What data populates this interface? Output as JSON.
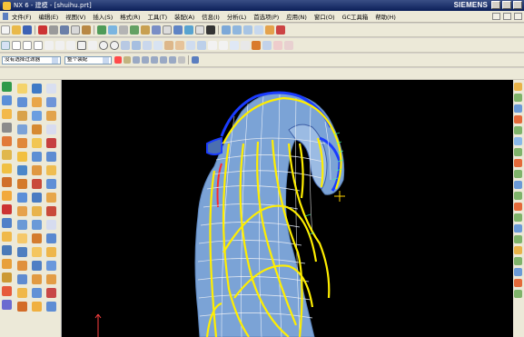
{
  "window": {
    "title": "NX 6 - 建模 - [shuihu.prt]",
    "brand": "SIEMENS"
  },
  "menu": {
    "items": [
      "文件(F)",
      "编辑(E)",
      "视图(V)",
      "插入(S)",
      "格式(R)",
      "工具(T)",
      "装配(A)",
      "信息(I)",
      "分析(L)",
      "首选项(P)",
      "应用(N)",
      "窗口(O)",
      "GC工具箱",
      "帮助(H)"
    ]
  },
  "selection_bar": {
    "filter_value": "没有选择过滤器",
    "scope_value": "整个装配"
  },
  "viewport": {
    "background": "#000000",
    "body_color": "#7ba3d6",
    "edge_color": "#1a3cff",
    "curve_color": "#ffee00",
    "accent_color": "#ff2a2a",
    "grid_color": "#dfe6f0"
  },
  "toolbar_icons": {
    "standard": [
      "new-icon",
      "open-icon",
      "save-icon",
      "undo-icon",
      "redo-icon",
      "cut-icon",
      "copy-icon",
      "paste-icon",
      "fit-icon",
      "zoom-icon",
      "pan-icon",
      "rotate-icon",
      "render-style-icon",
      "color-icon",
      "layer-icon",
      "wcs-icon"
    ],
    "sketch": [
      "line-icon",
      "arc-icon",
      "spline-icon",
      "text-icon",
      "point-icon",
      "rectangle-icon",
      "polygon-icon",
      "ellipse-icon",
      "circle-icon",
      "fillet-icon",
      "trim-icon",
      "extend-icon",
      "offset-icon",
      "mirror-icon",
      "project-icon",
      "constraint-icon"
    ],
    "left_column_count": 27
  }
}
